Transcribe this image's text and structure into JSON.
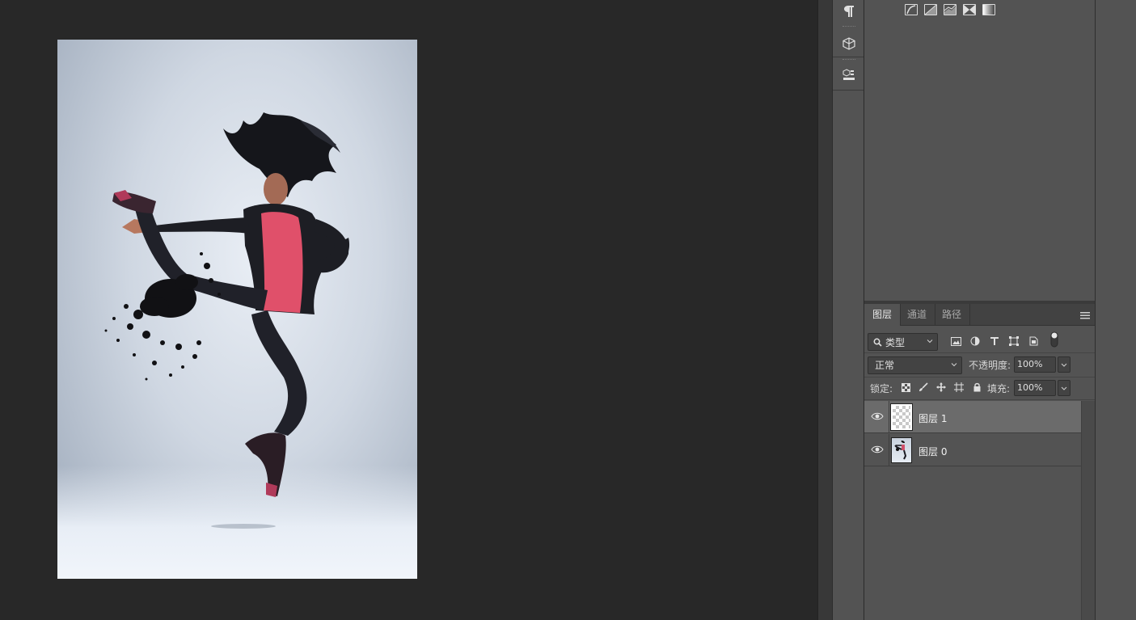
{
  "canvas": {
    "description_alt": "dancer-photo"
  },
  "tool_strip": {
    "icons": [
      "paragraph-icon",
      "3d-cube-icon",
      "3d-scene-icon"
    ]
  },
  "adjustments": {
    "icons": [
      "levels-icon",
      "curves-icon",
      "exposure-icon",
      "invert-icon",
      "gradient-map-icon"
    ]
  },
  "layers_panel": {
    "tabs": [
      {
        "label": "图层",
        "active": true
      },
      {
        "label": "通道",
        "active": false
      },
      {
        "label": "路径",
        "active": false
      }
    ],
    "filter": {
      "label": "类型"
    },
    "blend_mode": "正常",
    "opacity_label": "不透明度:",
    "opacity_value": "100%",
    "lock_label": "锁定:",
    "fill_label": "填充:",
    "fill_value": "100%",
    "layers": [
      {
        "name": "图层 1",
        "selected": true,
        "visible": true
      },
      {
        "name": "图层 0",
        "selected": false,
        "visible": true
      }
    ]
  },
  "colors": {
    "panel_bg": "#535353",
    "workspace_bg": "#282828",
    "selected_layer": "#6b6b6b"
  }
}
